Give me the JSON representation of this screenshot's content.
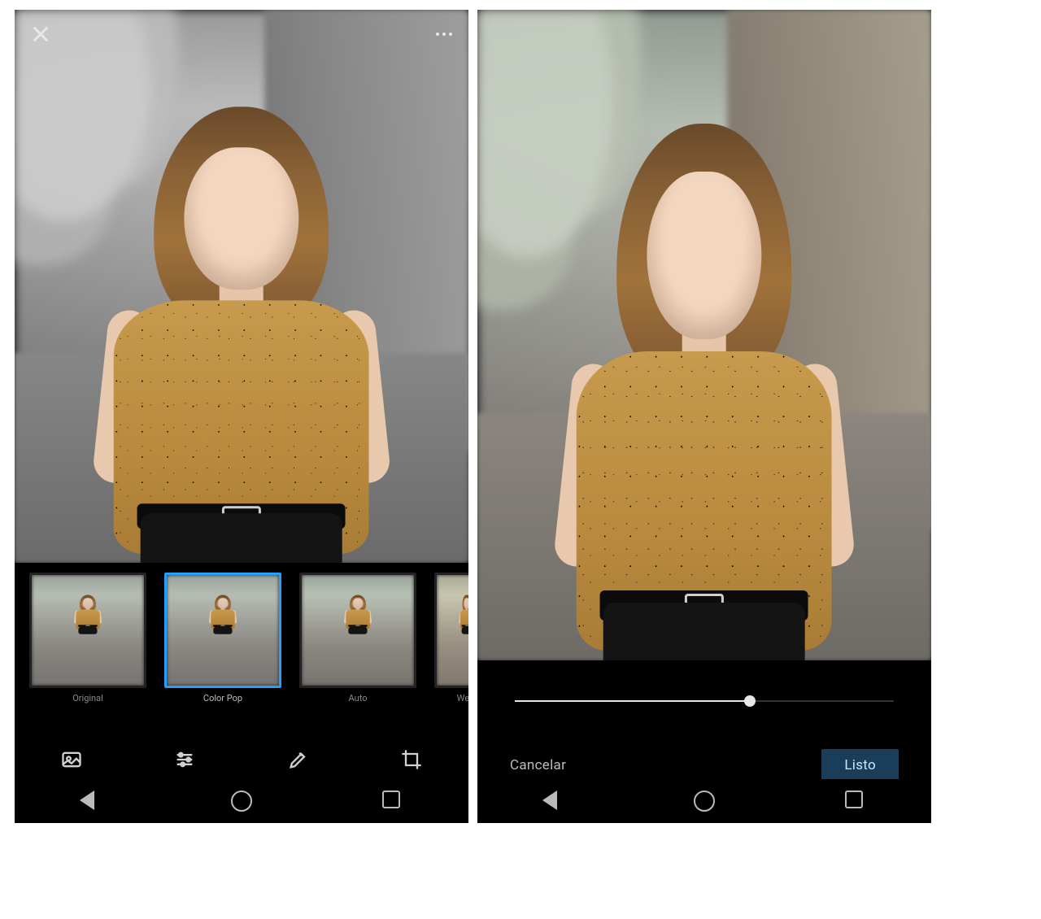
{
  "leftPanel": {
    "header": {
      "title": ""
    },
    "filters": [
      {
        "id": "original",
        "label": "Original",
        "selected": false
      },
      {
        "id": "color-pop",
        "label": "Color Pop",
        "selected": true
      },
      {
        "id": "auto",
        "label": "Auto",
        "selected": false
      },
      {
        "id": "west",
        "label": "West",
        "selected": false
      }
    ],
    "modes": [
      {
        "id": "filters",
        "active": true
      },
      {
        "id": "adjust",
        "active": false
      },
      {
        "id": "markup",
        "active": false
      },
      {
        "id": "crop",
        "active": false
      }
    ]
  },
  "rightPanel": {
    "slider": {
      "valuePct": 62
    },
    "actions": {
      "cancel": "Cancelar",
      "done": "Listo"
    }
  }
}
